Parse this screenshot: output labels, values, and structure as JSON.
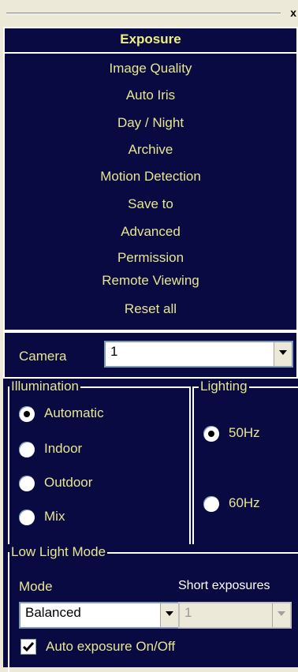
{
  "window": {
    "close_label": "x"
  },
  "menu": {
    "items": [
      "Exposure",
      "Image Quality",
      "Auto Iris",
      "Day / Night",
      "Archive",
      "Motion Detection",
      "Save to",
      "Advanced",
      "Permission",
      "Remote Viewing",
      "Reset all"
    ],
    "selected": "Exposure"
  },
  "camera": {
    "label": "Camera",
    "value": "1"
  },
  "illumination": {
    "title": "Illumination",
    "options": [
      "Automatic",
      "Indoor",
      "Outdoor",
      "Mix"
    ],
    "selected": "Automatic"
  },
  "lighting": {
    "title": "Lighting",
    "options": [
      "50Hz",
      "60Hz"
    ],
    "selected": "50Hz"
  },
  "low_light": {
    "title": "Low Light Mode",
    "mode_label": "Mode",
    "mode_value": "Balanced",
    "short_exposures_label": "Short exposures",
    "short_exposures_value": "1",
    "auto_exposure_label": "Auto exposure On/Off",
    "auto_exposure_checked": true
  },
  "colors": {
    "panel": "#0a0a42",
    "text": "#e6e690",
    "border": "#ffffff"
  }
}
